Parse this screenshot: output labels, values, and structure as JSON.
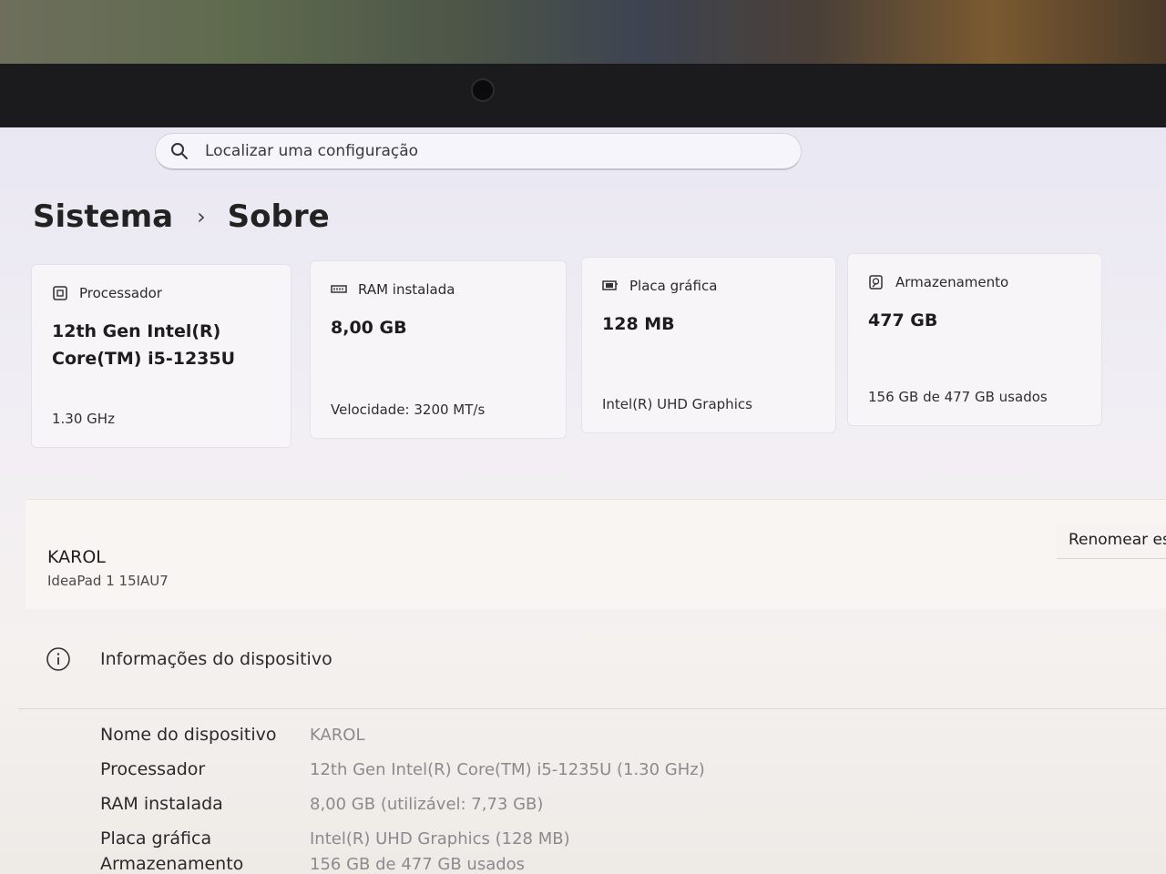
{
  "search": {
    "placeholder": "Localizar uma configuração"
  },
  "breadcrumb": {
    "parent": "Sistema",
    "separator": "›",
    "current": "Sobre"
  },
  "cards": [
    {
      "icon": "processor-icon",
      "label": "Processador",
      "value": "12th Gen Intel(R) Core(TM) i5-1235U",
      "footer": "1.30 GHz"
    },
    {
      "icon": "memory-icon",
      "label": "RAM instalada",
      "value": "8,00 GB",
      "footer": "Velocidade: 3200 MT/s"
    },
    {
      "icon": "display-adapter-icon",
      "label": "Placa gráfica",
      "value": "128 MB",
      "footer": "Intel(R) UHD Graphics"
    },
    {
      "icon": "storage-icon",
      "label": "Armazenamento",
      "value": "477 GB",
      "footer": "156 GB de 477 GB usados"
    }
  ],
  "device": {
    "name": "KAROL",
    "model": "IdeaPad 1 15IAU7",
    "rename_label": "Renomear es"
  },
  "device_info": {
    "title": "Informações do dispositivo",
    "rows": [
      {
        "key": "Nome do dispositivo",
        "value": "KAROL"
      },
      {
        "key": "Processador",
        "value": "12th Gen Intel(R) Core(TM) i5-1235U (1.30 GHz)"
      },
      {
        "key": "RAM instalada",
        "value": "8,00 GB (utilizável: 7,73 GB)"
      },
      {
        "key": "Placa gráfica",
        "value": "Intel(R) UHD Graphics (128 MB)"
      },
      {
        "key": "Armazenamento",
        "value": "156 GB de 477 GB usados"
      }
    ]
  }
}
